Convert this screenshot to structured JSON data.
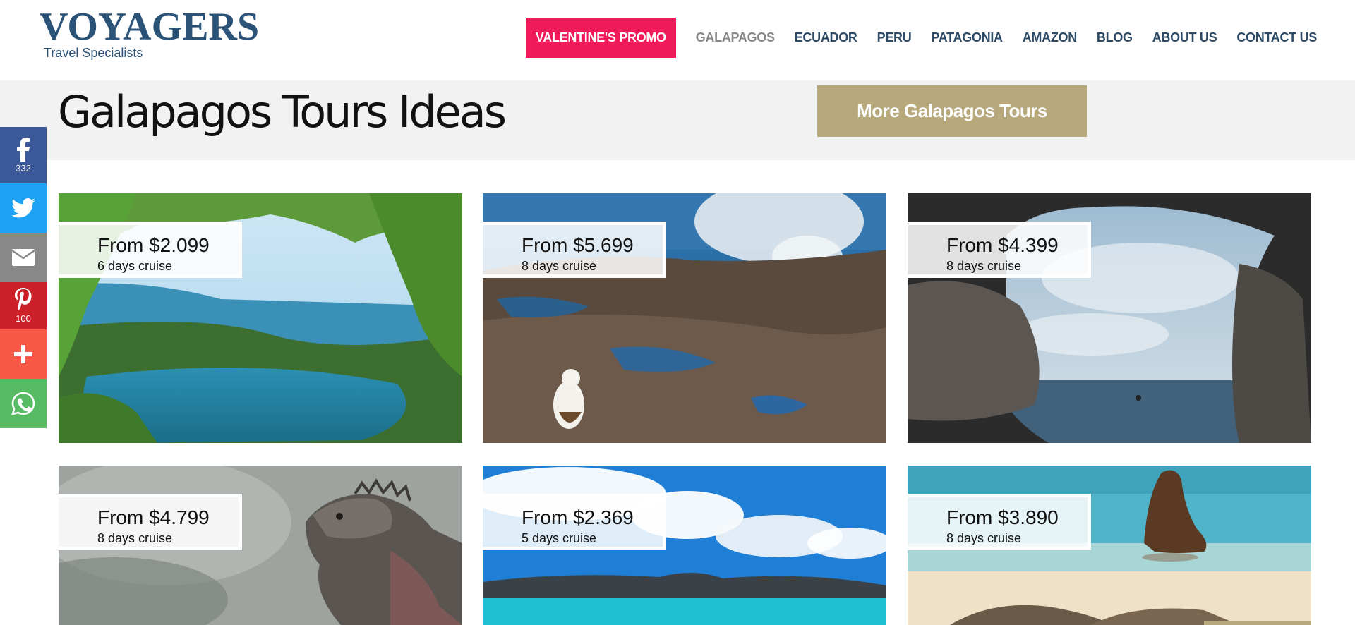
{
  "logo": {
    "word": "VOYAGERS",
    "sub": "Travel Specialists"
  },
  "nav": {
    "promo": "VALENTINE'S PROMO",
    "items": [
      "GALAPAGOS",
      "ECUADOR",
      "PERU",
      "PATAGONIA",
      "AMAZON",
      "BLOG",
      "ABOUT US",
      "CONTACT US"
    ]
  },
  "banner": {
    "title": "Galapagos Tours Ideas",
    "button": "More Galapagos Tours"
  },
  "social": {
    "facebook_count": "332",
    "pinterest_count": "100",
    "icons": [
      "facebook-icon",
      "twitter-icon",
      "email-icon",
      "pinterest-icon",
      "plus-icon",
      "whatsapp-icon"
    ]
  },
  "tours": [
    {
      "price": "From $2.099",
      "days": "6 days cruise"
    },
    {
      "price": "From $5.699",
      "days": "8 days cruise"
    },
    {
      "price": "From $4.399",
      "days": "8 days cruise"
    },
    {
      "price": "From $4.799",
      "days": "8 days cruise"
    },
    {
      "price": "From $2.369",
      "days": "5 days cruise"
    },
    {
      "price": "From $3.890",
      "days": "8 days cruise"
    }
  ],
  "colors": {
    "promo": "#ee1a5a",
    "button": "#b7a97c",
    "nav_text": "#2d4a66",
    "brand": "#2b5277"
  }
}
